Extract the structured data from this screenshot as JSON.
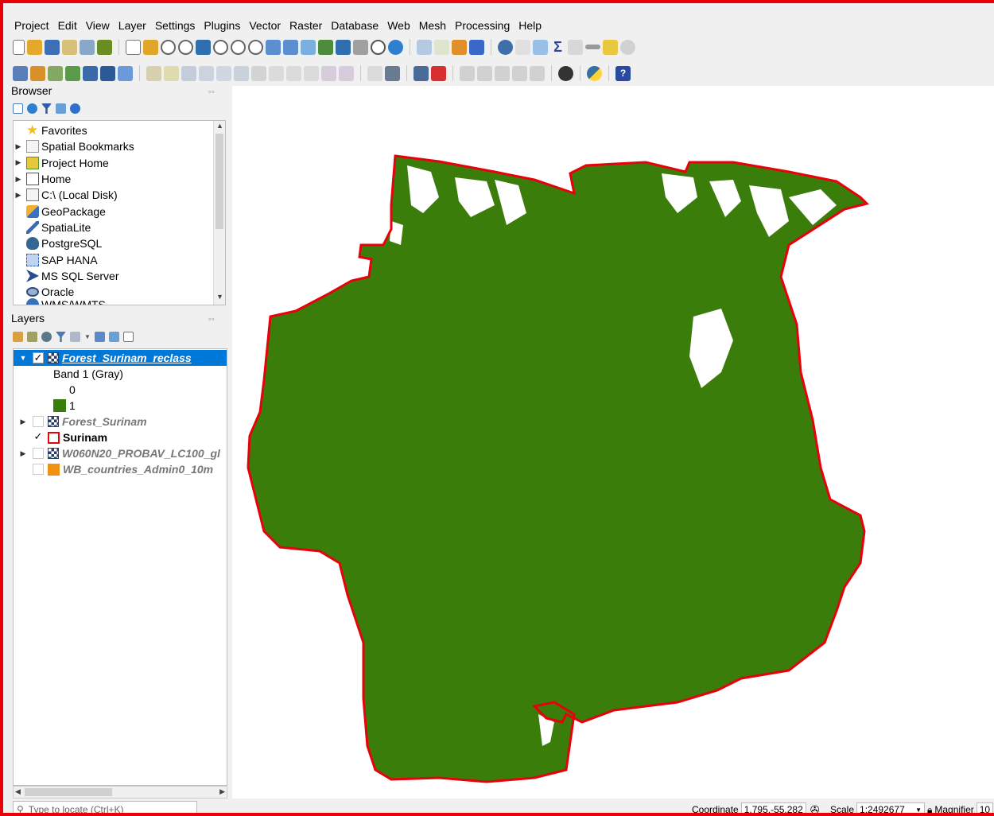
{
  "menu": [
    "Project",
    "Edit",
    "View",
    "Layer",
    "Settings",
    "Plugins",
    "Vector",
    "Raster",
    "Database",
    "Web",
    "Mesh",
    "Processing",
    "Help"
  ],
  "browser": {
    "title": "Browser",
    "items": [
      {
        "label": "Favorites",
        "icon": "star-icon",
        "expand": false
      },
      {
        "label": "Spatial Bookmarks",
        "icon": "bookmark-icon",
        "expand": true
      },
      {
        "label": "Project Home",
        "icon": "project-home-icon",
        "expand": true
      },
      {
        "label": "Home",
        "icon": "home-icon",
        "expand": true
      },
      {
        "label": "C:\\ (Local Disk)",
        "icon": "disk-icon",
        "expand": true
      },
      {
        "label": "GeoPackage",
        "icon": "geopackage-icon",
        "expand": false
      },
      {
        "label": "SpatiaLite",
        "icon": "spatialite-icon",
        "expand": false
      },
      {
        "label": "PostgreSQL",
        "icon": "postgresql-icon",
        "expand": false
      },
      {
        "label": "SAP HANA",
        "icon": "sap-hana-icon",
        "expand": false
      },
      {
        "label": "MS SQL Server",
        "icon": "mssql-icon",
        "expand": false
      },
      {
        "label": "Oracle",
        "icon": "oracle-icon",
        "expand": false
      },
      {
        "label": "WMS/WMTS",
        "icon": "wms-icon",
        "expand": false
      }
    ]
  },
  "layers": {
    "title": "Layers",
    "items": [
      {
        "name": "Forest_Surinam_reclass",
        "checked": true,
        "type": "raster",
        "selected": true
      },
      {
        "name": "Band 1 (Gray)",
        "type": "legend-heading"
      },
      {
        "name": "0",
        "type": "legend-class",
        "color": "#ffffff"
      },
      {
        "name": "1",
        "type": "legend-class",
        "color": "#3a7d0a"
      },
      {
        "name": "Forest_Surinam",
        "checked": false,
        "type": "raster"
      },
      {
        "name": "Surinam",
        "checked": true,
        "type": "vector",
        "color": "#e8000b"
      },
      {
        "name": "W060N20_PROBAV_LC100_gl",
        "checked": false,
        "type": "raster"
      },
      {
        "name": "WB_countries_Admin0_10m",
        "checked": false,
        "type": "vector-fill",
        "color": "#f29111"
      }
    ]
  },
  "status": {
    "locate_placeholder": "Type to locate (Ctrl+K)",
    "coordinate_label": "Coordinate",
    "coordinate_value": "1.795,-55.282",
    "scale_label": "Scale",
    "scale_value": "1:2492677",
    "magnifier_label": "Magnifier",
    "magnifier_value": "10"
  },
  "colors": {
    "forest": "#3a7d0a",
    "border": "#e8000b",
    "selection": "#0078d7"
  }
}
